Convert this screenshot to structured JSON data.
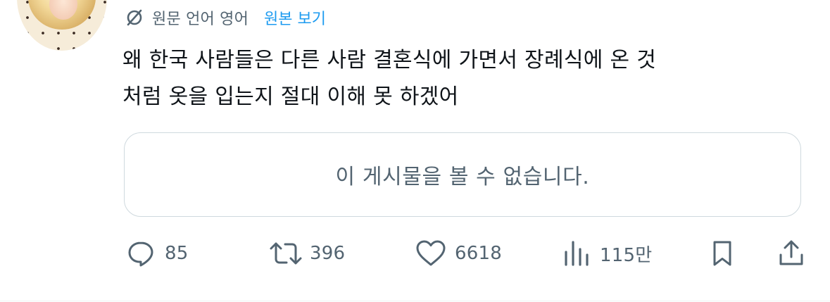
{
  "translation": {
    "source_label": "원문 언어 영어",
    "show_original_label": "원본 보기"
  },
  "tweet": {
    "text_lines": [
      "왜 한국 사람들은 다른 사람 결혼식에 가면서 장례식에 온 것",
      "처럼 옷을 입는지 절대 이해 못 하겠어"
    ]
  },
  "quoted_post": {
    "unavailable_message": "이 게시물을 볼 수 없습니다."
  },
  "actions": {
    "reply_count": "85",
    "repost_count": "396",
    "like_count": "6618",
    "view_count": "115만"
  },
  "icons": {
    "translate": "translate-icon",
    "reply": "reply-icon",
    "repost": "repost-icon",
    "like": "heart-icon",
    "views": "views-chart-icon",
    "bookmark": "bookmark-icon",
    "share": "share-icon"
  },
  "colors": {
    "text_primary": "#0f1419",
    "text_secondary": "#536471",
    "link_blue": "#1d9bf0",
    "border": "#cfd9de"
  }
}
